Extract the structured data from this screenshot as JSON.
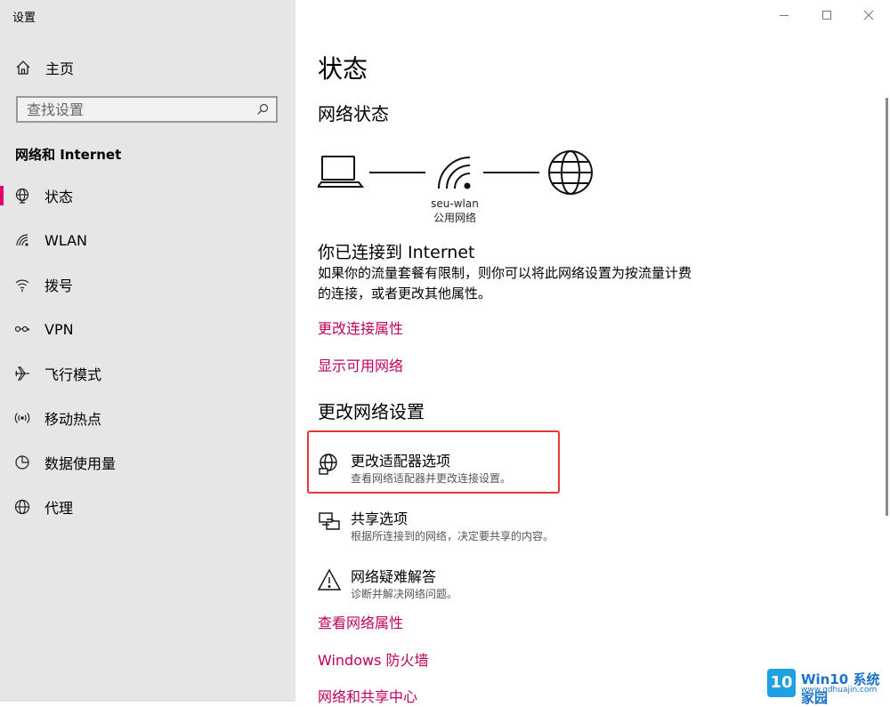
{
  "window": {
    "title": "设置"
  },
  "sidebar": {
    "home_label": "主页",
    "search_placeholder": "查找设置",
    "section_heading": "网络和 Internet",
    "items": [
      {
        "label": "状态",
        "icon": "globe-status-icon",
        "selected": true
      },
      {
        "label": "WLAN",
        "icon": "wifi-icon"
      },
      {
        "label": "拨号",
        "icon": "dialup-icon"
      },
      {
        "label": "VPN",
        "icon": "vpn-icon"
      },
      {
        "label": "飞行模式",
        "icon": "airplane-icon"
      },
      {
        "label": "移动热点",
        "icon": "hotspot-icon"
      },
      {
        "label": "数据使用量",
        "icon": "data-usage-icon"
      },
      {
        "label": "代理",
        "icon": "globe-icon"
      }
    ]
  },
  "main": {
    "page_title": "状态",
    "network_status_heading": "网络状态",
    "network": {
      "ssid": "seu-wlan",
      "profile": "公用网络"
    },
    "connected_title": "你已连接到 Internet",
    "connected_desc": "如果你的流量套餐有限制，则你可以将此网络设置为按流量计费的连接，或者更改其他属性。",
    "link_change_connection": "更改连接属性",
    "link_show_networks": "显示可用网络",
    "change_settings_heading": "更改网络设置",
    "options": [
      {
        "title": "更改适配器选项",
        "desc": "查看网络适配器并更改连接设置。",
        "icon": "adapter-icon",
        "highlighted": true
      },
      {
        "title": "共享选项",
        "desc": "根据所连接到的网络，决定要共享的内容。",
        "icon": "sharing-icon"
      },
      {
        "title": "网络疑难解答",
        "desc": "诊断并解决网络问题。",
        "icon": "warning-icon"
      }
    ],
    "link_view_properties": "查看网络属性",
    "link_firewall": "Windows 防火墙",
    "link_sharing_center": "网络和共享中心"
  },
  "colors": {
    "accent": "#e0006c",
    "link": "#c0005e",
    "highlight_box": "#e53935",
    "sidebar_bg": "#e6e6e6"
  },
  "watermark": {
    "logo": "10",
    "name": "Win10 系统家园",
    "url": "www.qdhuajin.com"
  }
}
